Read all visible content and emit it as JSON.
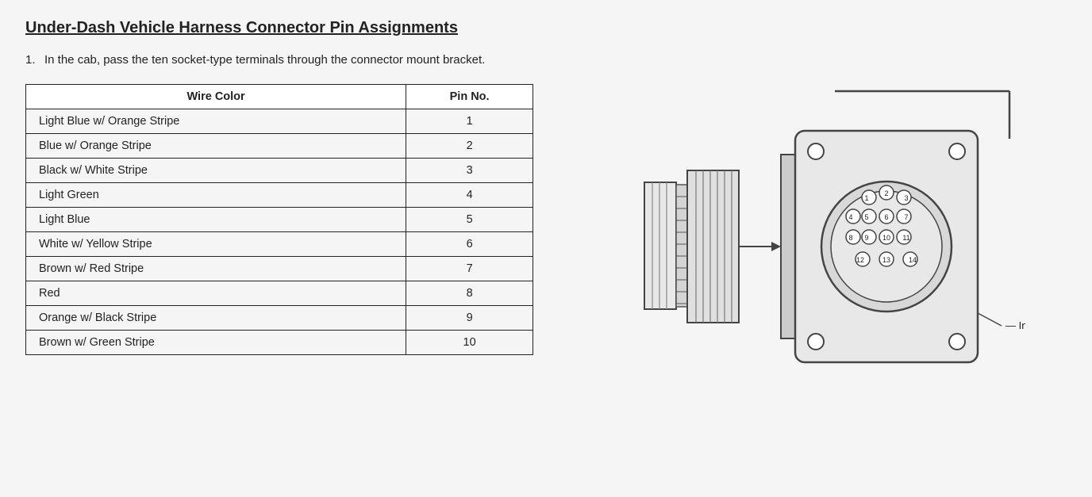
{
  "title": "Under-Dash Vehicle Harness Connector Pin Assignments",
  "intro": {
    "number": "1.",
    "text": "In the cab, pass the ten socket-type terminals through the connector mount bracket."
  },
  "table": {
    "col1_header": "Wire Color",
    "col2_header": "Pin No.",
    "rows": [
      {
        "wire_color": "Light Blue w/ Orange Stripe",
        "pin_no": "1"
      },
      {
        "wire_color": "Blue w/ Orange Stripe",
        "pin_no": "2"
      },
      {
        "wire_color": "Black w/ White Stripe",
        "pin_no": "3"
      },
      {
        "wire_color": "Light Green",
        "pin_no": "4"
      },
      {
        "wire_color": "Light Blue",
        "pin_no": "5"
      },
      {
        "wire_color": "White w/ Yellow Stripe",
        "pin_no": "6"
      },
      {
        "wire_color": "Brown w/ Red Stripe",
        "pin_no": "7"
      },
      {
        "wire_color": "Red",
        "pin_no": "8"
      },
      {
        "wire_color": "Orange w/ Black Stripe",
        "pin_no": "9"
      },
      {
        "wire_color": "Brown w/ Green Stripe",
        "pin_no": "10"
      }
    ]
  },
  "diagram": {
    "insert_label": "Insert Pins Into This Side"
  }
}
